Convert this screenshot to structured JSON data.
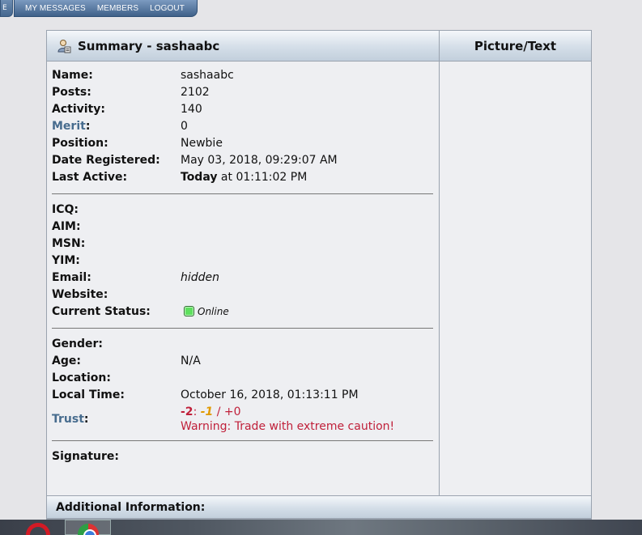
{
  "topnav": {
    "stub": "E",
    "tabs": [
      "MY MESSAGES",
      "MEMBERS",
      "LOGOUT"
    ]
  },
  "summary": {
    "header": "Summary - sashaabc",
    "rows_basic": [
      {
        "label": "Name:",
        "value": "sashaabc"
      },
      {
        "label": "Posts:",
        "value": "2102"
      },
      {
        "label": "Activity:",
        "value": "140"
      },
      {
        "label": "Merit",
        "value": "0"
      },
      {
        "label": "Position:",
        "value": "Newbie"
      },
      {
        "label": "Date Registered:",
        "value": "May 03, 2018, 09:29:07 AM"
      },
      {
        "label": "Last Active:",
        "value_bold": "Today",
        "value_rest": " at 01:11:02 PM"
      }
    ],
    "rows_contact": [
      {
        "label": "ICQ:",
        "value": ""
      },
      {
        "label": "AIM:",
        "value": ""
      },
      {
        "label": "MSN:",
        "value": ""
      },
      {
        "label": "YIM:",
        "value": ""
      },
      {
        "label": "Email:",
        "value": "hidden"
      },
      {
        "label": "Website:",
        "value": ""
      },
      {
        "label": "Current Status:",
        "value": "Online"
      }
    ],
    "rows_personal": [
      {
        "label": "Gender:",
        "value": ""
      },
      {
        "label": "Age:",
        "value": "N/A"
      },
      {
        "label": "Location:",
        "value": ""
      },
      {
        "label": "Local Time:",
        "value": "October 16, 2018, 01:13:11 PM"
      }
    ],
    "trust": {
      "label": "Trust",
      "score_neg": "-2",
      "score_mid": "-1",
      "score_pos": "+0",
      "warning": "Warning: Trade with extreme caution!"
    },
    "signature_label": "Signature:"
  },
  "picture": {
    "header": "Picture/Text"
  },
  "additional": {
    "header": "Additional Information:"
  },
  "colors": {
    "nav": "#45678f",
    "link_label": "#476c8e",
    "trust_red": "#c0203a",
    "trust_orange": "#e19a00",
    "online_green": "#5ee05e"
  }
}
